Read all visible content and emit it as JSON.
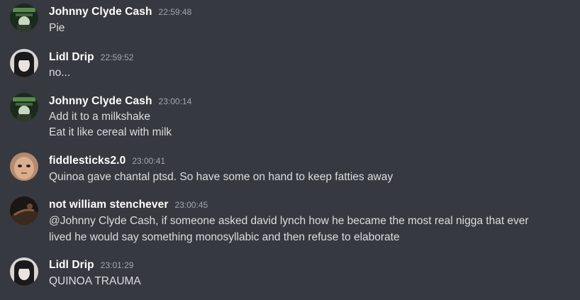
{
  "messages": [
    {
      "author": "Johnny Clyde Cash",
      "time": "22:59:48",
      "avatar_icon": "johnny-avatar-icon",
      "lines": [
        "Pie"
      ]
    },
    {
      "author": "Lidl Drip",
      "time": "22:59:52",
      "avatar_icon": "lidl-avatar-icon",
      "lines": [
        "no..."
      ]
    },
    {
      "author": "Johnny Clyde Cash",
      "time": "23:00:14",
      "avatar_icon": "johnny-avatar-icon",
      "lines": [
        "Add it to a milkshake",
        "Eat it like cereal with milk"
      ]
    },
    {
      "author": "fiddlesticks2.0",
      "time": "23:00:41",
      "avatar_icon": "fiddlesticks-avatar-icon",
      "lines": [
        "Quinoa gave chantal ptsd. So have some on hand to keep fatties away"
      ]
    },
    {
      "author": "not william stenchever",
      "time": "23:00:45",
      "avatar_icon": "william-avatar-icon",
      "lines": [
        "@Johnny Clyde Cash, if someone asked david lynch how he became the most real nigga that ever",
        "lived he would say something monosyllabic and then refuse to elaborate"
      ]
    },
    {
      "author": "Lidl Drip",
      "time": "23:01:29",
      "avatar_icon": "lidl-avatar-icon",
      "lines": [
        "QUINOA TRAUMA"
      ]
    }
  ],
  "colors": {
    "background": "#36393f",
    "author": "#ffffff",
    "timestamp": "#a3a6aa",
    "text": "#dcddde"
  }
}
